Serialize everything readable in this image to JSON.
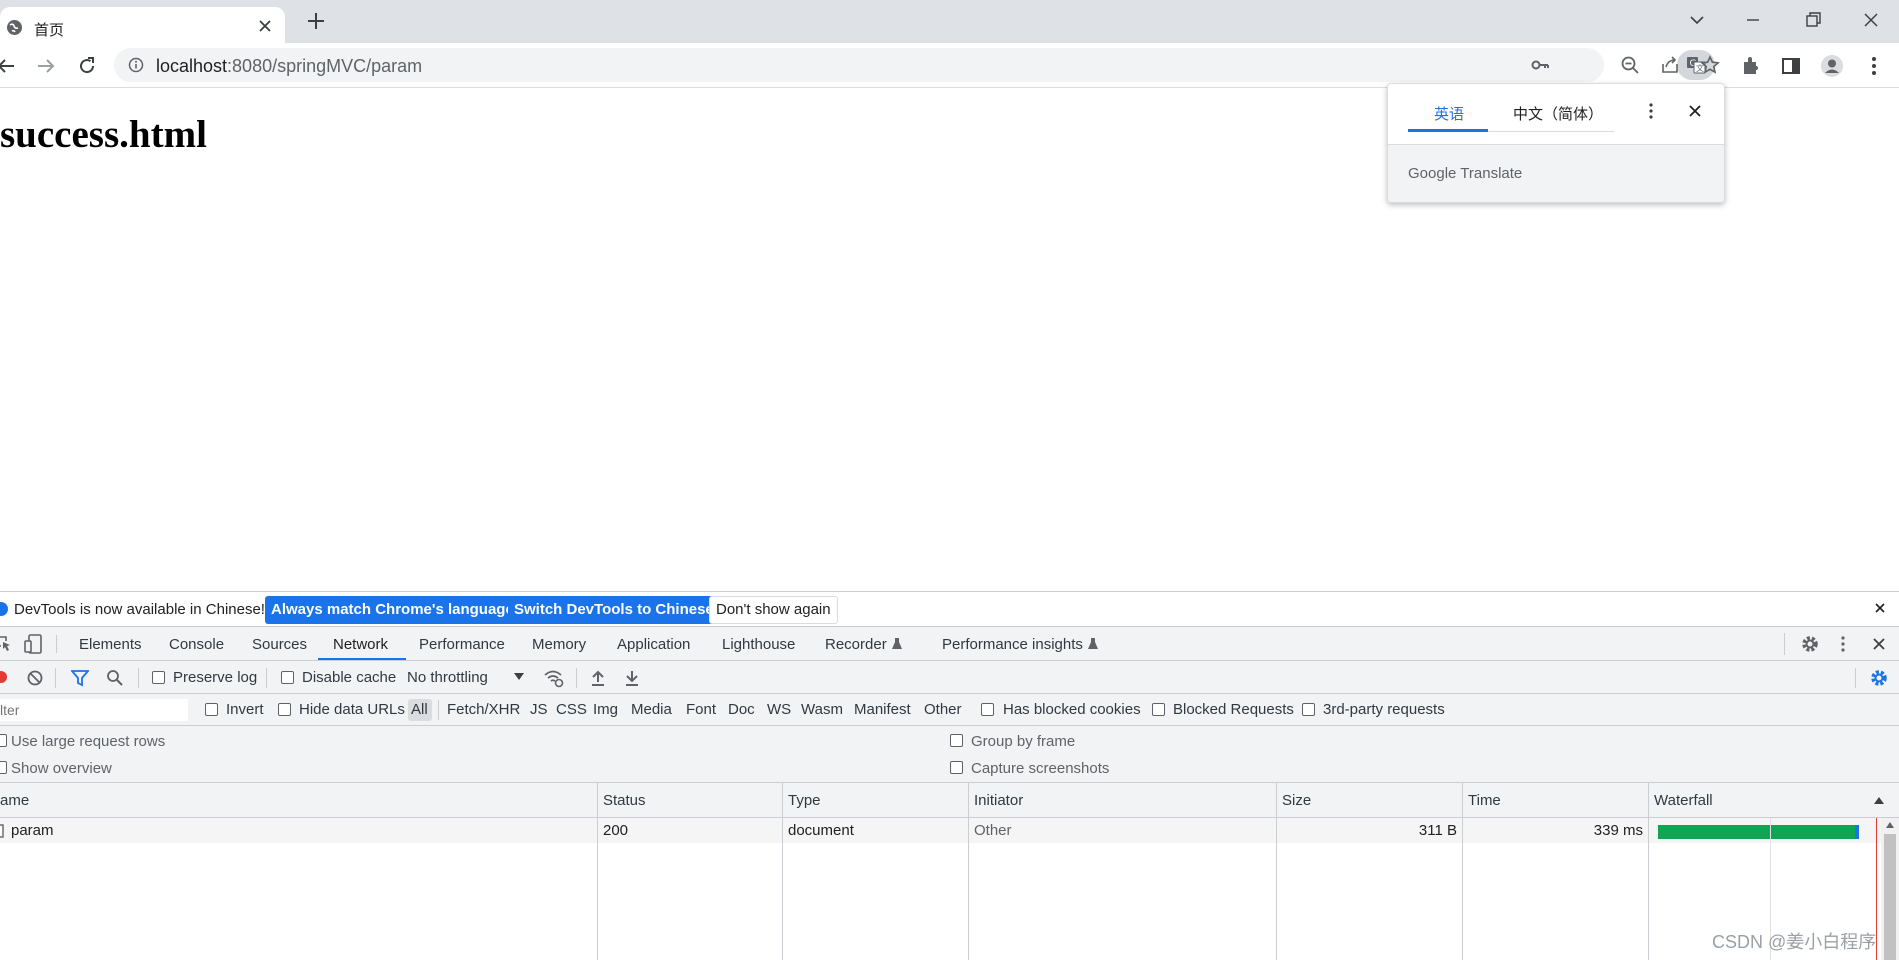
{
  "browser": {
    "tab": {
      "title": "首页",
      "favicon": "globe-icon"
    },
    "address": {
      "host": "localhost",
      "path": ":8080/springMVC/param"
    },
    "colors": {
      "accent": "#1a73e8",
      "tabstrip": "#dee1e6"
    }
  },
  "page": {
    "heading": "success.html"
  },
  "translate": {
    "tab_source": "英语",
    "tab_target": "中文（简体）",
    "brand_google": "Google",
    "brand_translate": "Translate"
  },
  "devtools": {
    "infobar": {
      "message": "DevTools is now available in Chinese!",
      "always_match": "Always match Chrome's language",
      "switch": "Switch DevTools to Chinese",
      "dont_show": "Don't show again"
    },
    "tabs": [
      "Elements",
      "Console",
      "Sources",
      "Network",
      "Performance",
      "Memory",
      "Application",
      "Lighthouse",
      "Recorder",
      "Performance insights"
    ],
    "active_tab": "Network",
    "network_toolbar": {
      "preserve_log": "Preserve log",
      "disable_cache": "Disable cache",
      "throttling": "No throttling"
    },
    "filter": {
      "placeholder": "lter",
      "invert": "Invert",
      "hide_data_urls": "Hide data URLs",
      "types": [
        "All",
        "Fetch/XHR",
        "JS",
        "CSS",
        "Img",
        "Media",
        "Font",
        "Doc",
        "WS",
        "Wasm",
        "Manifest",
        "Other"
      ],
      "has_blocked_cookies": "Has blocked cookies",
      "blocked_requests": "Blocked Requests",
      "third_party": "3rd-party requests"
    },
    "settings": {
      "large_rows": "Use large request rows",
      "show_overview": "Show overview",
      "group_by_frame": "Group by frame",
      "capture_screenshots": "Capture screenshots"
    },
    "table": {
      "columns": [
        "ame",
        "Status",
        "Type",
        "Initiator",
        "Size",
        "Time",
        "Waterfall"
      ],
      "rows": [
        {
          "name": "param",
          "status": "200",
          "type": "document",
          "initiator": "Other",
          "size": "311 B",
          "time": "339 ms"
        }
      ]
    }
  },
  "watermark": "CSDN @姜小白程序"
}
